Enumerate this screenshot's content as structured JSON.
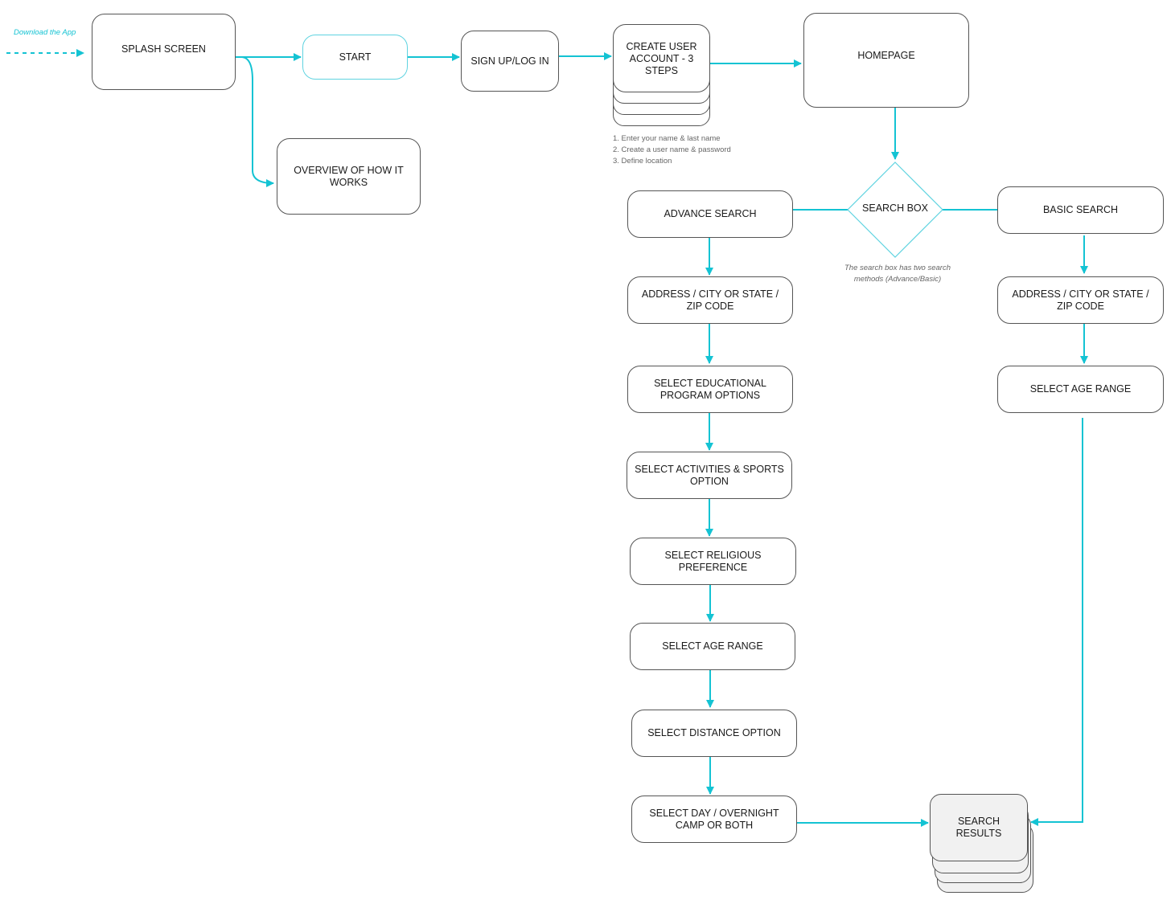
{
  "colors": {
    "connector": "#14c3d3",
    "node_border": "#555555",
    "diamond": "#5fd3e0",
    "results_fill": "#f1f1f1"
  },
  "entry": {
    "label": "Download the App"
  },
  "nodes": {
    "splash": "SPLASH SCREEN",
    "start": "START",
    "overview": "OVERVIEW OF HOW IT WORKS",
    "signup": "SIGN UP/LOG IN",
    "create_account": "CREATE USER ACCOUNT - 3 STEPS",
    "homepage": "HOMEPAGE",
    "search_box": "SEARCH BOX",
    "advance_search": "ADVANCE SEARCH",
    "basic_search": "BASIC SEARCH",
    "adv_address": "ADDRESS / CITY OR STATE / ZIP CODE",
    "adv_education": "SELECT EDUCATIONAL PROGRAM OPTIONS",
    "adv_activities": "SELECT ACTIVITIES & SPORTS OPTION",
    "adv_religious": "SELECT RELIGIOUS PREFERENCE",
    "adv_age": "SELECT AGE RANGE",
    "adv_distance": "SELECT DISTANCE OPTION",
    "adv_camp": "SELECT DAY / OVERNIGHT CAMP OR BOTH",
    "basic_address": "ADDRESS / CITY OR STATE / ZIP CODE",
    "basic_age": "SELECT AGE RANGE",
    "results": "SEARCH RESULTS"
  },
  "account_steps": [
    "1. Enter your name & last name",
    "2. Create a user name & password",
    "3. Define location"
  ],
  "search_box_note": {
    "line1": "The search box has two search",
    "line2": "methods (Advance/Basic)"
  }
}
